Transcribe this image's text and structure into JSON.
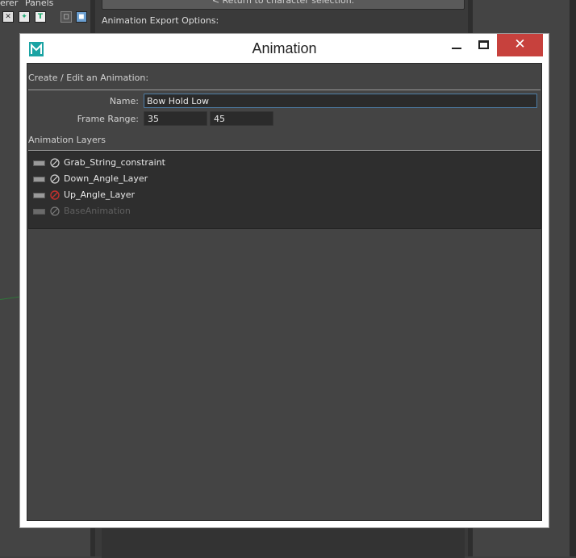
{
  "background": {
    "menu": [
      "erer",
      "Panels"
    ],
    "return_button": "<   Return to character selection.",
    "export_label": "Animation Export Options:"
  },
  "window": {
    "title": "Animation",
    "close_symbol": "✕",
    "create_label": "Create / Edit an Animation:",
    "name_label": "Name:",
    "name_value": "Bow Hold Low",
    "frame_range_label": "Frame Range:",
    "frame_start": "35",
    "frame_end": "45",
    "layers_label": "Animation Layers",
    "layers": [
      {
        "name": "Grab_String_constraint",
        "muted": false,
        "active": true
      },
      {
        "name": "Down_Angle_Layer",
        "muted": false,
        "active": true
      },
      {
        "name": "Up_Angle_Layer",
        "muted": true,
        "active": true
      },
      {
        "name": "BaseAnimation",
        "muted": false,
        "active": false
      }
    ]
  },
  "colors": {
    "close_button": "#c7413d",
    "window_content": "#444444",
    "mute_active_red": "#c0302c"
  }
}
